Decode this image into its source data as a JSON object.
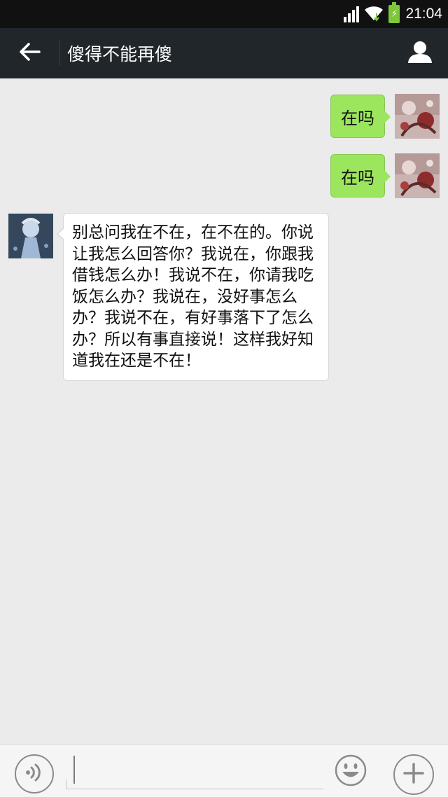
{
  "status_bar": {
    "time": "21:04"
  },
  "header": {
    "title": "傻得不能再傻"
  },
  "messages": [
    {
      "side": "right",
      "text": "在吗"
    },
    {
      "side": "right",
      "text": "在吗"
    },
    {
      "side": "left",
      "text": "别总问我在不在，在不在的。你说让我怎么回答你？我说在，你跟我借钱怎么办！我说不在，你请我吃饭怎么办？我说在，没好事怎么办？我说不在，有好事落下了怎么办？所以有事直接说！这样我好知道我在还是不在！"
    }
  ],
  "input": {
    "value": ""
  },
  "icons": {
    "back": "back-arrow-icon",
    "profile": "person-icon",
    "voice": "voice-icon",
    "emoji": "smiley-icon",
    "plus": "plus-icon",
    "wifi": "wifi-icon",
    "signal": "signal-icon",
    "battery": "battery-charging-icon"
  },
  "colors": {
    "header_bg": "#20262a",
    "chat_bg": "#ebebeb",
    "sent_bubble": "#9ce65e",
    "received_bubble": "#ffffff"
  }
}
